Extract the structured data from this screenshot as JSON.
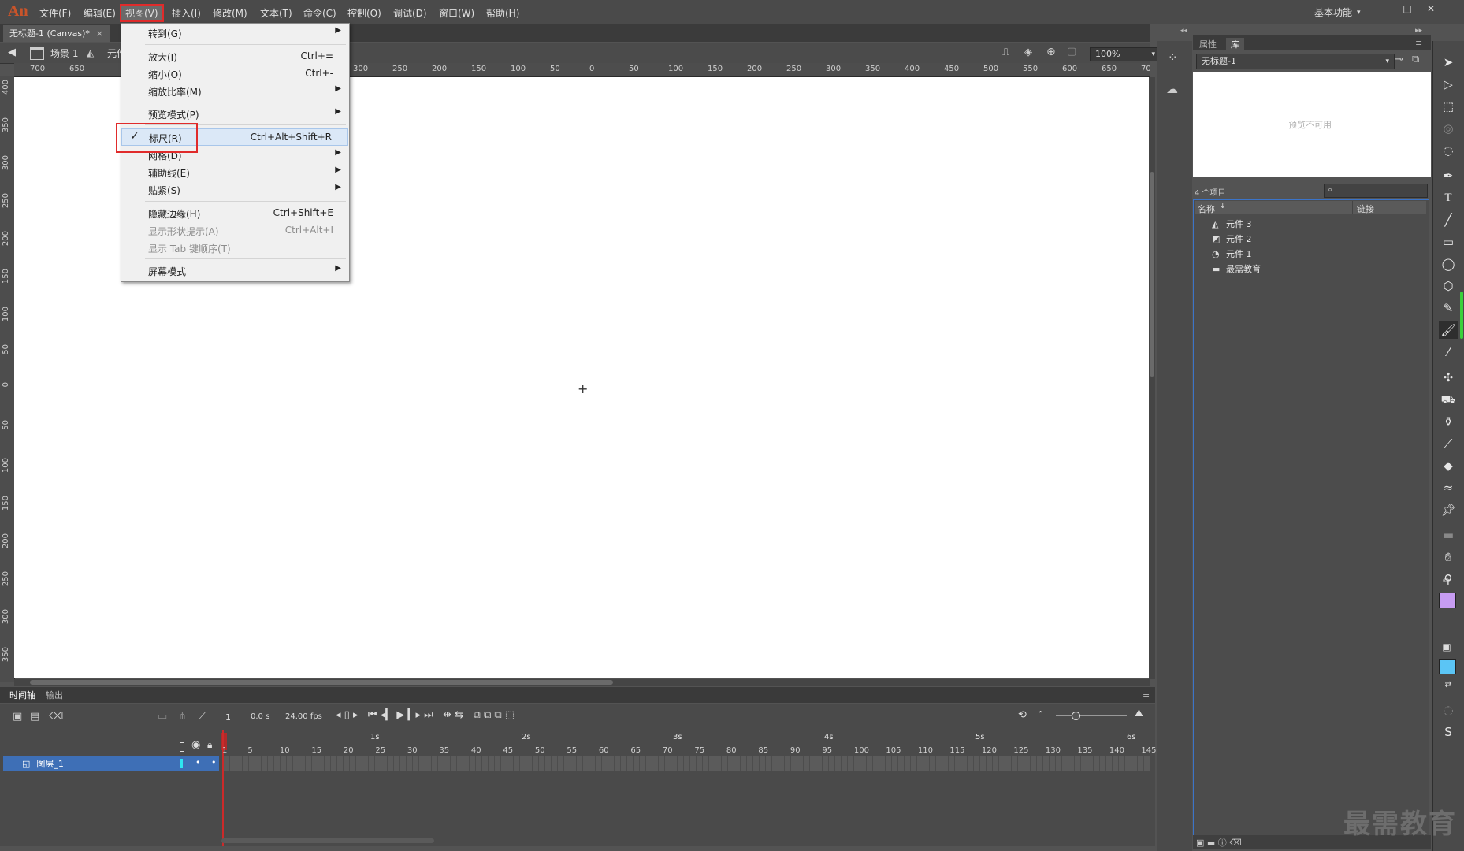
{
  "app": {
    "logo": "An",
    "workspace": "基本功能",
    "workspace_arrow": "▾"
  },
  "menubar": [
    "文件(F)",
    "编辑(E)",
    "视图(V)",
    "插入(I)",
    "修改(M)",
    "文本(T)",
    "命令(C)",
    "控制(O)",
    "调试(D)",
    "窗口(W)",
    "帮助(H)"
  ],
  "window_controls": {
    "minimize": "–",
    "maximize": "□",
    "close": "✕"
  },
  "document": {
    "tab_title": "无标题-1 (Canvas)*",
    "tab_close": "×",
    "scene": "场景 1",
    "symbol_crumb": "元件",
    "zoom": "100%"
  },
  "ruler_top": [
    "700",
    "650",
    "300",
    "250",
    "200",
    "150",
    "100",
    "50",
    "0",
    "50",
    "100",
    "150",
    "200",
    "250",
    "300",
    "350",
    "400",
    "450",
    "500",
    "550",
    "600",
    "650",
    "700"
  ],
  "ruler_left": [
    "400",
    "350",
    "300",
    "250",
    "200",
    "150",
    "100",
    "50",
    "0",
    "50",
    "100",
    "150",
    "200",
    "250",
    "300",
    "350"
  ],
  "view_menu": {
    "items": [
      {
        "label": "转到(G)",
        "shortcut": "",
        "submenu": true,
        "disabled": false
      },
      {
        "label": "放大(I)",
        "shortcut": "Ctrl+=",
        "submenu": false,
        "disabled": false
      },
      {
        "label": "缩小(O)",
        "shortcut": "Ctrl+-",
        "submenu": false,
        "disabled": false
      },
      {
        "label": "缩放比率(M)",
        "shortcut": "",
        "submenu": true,
        "disabled": false
      },
      {
        "label": "预览模式(P)",
        "shortcut": "",
        "submenu": true,
        "disabled": false
      },
      {
        "label": "标尺(R)",
        "shortcut": "Ctrl+Alt+Shift+R",
        "submenu": false,
        "disabled": false,
        "checked": true
      },
      {
        "label": "网格(D)",
        "shortcut": "",
        "submenu": true,
        "disabled": false
      },
      {
        "label": "辅助线(E)",
        "shortcut": "",
        "submenu": true,
        "disabled": false
      },
      {
        "label": "贴紧(S)",
        "shortcut": "",
        "submenu": true,
        "disabled": false
      },
      {
        "label": "隐藏边缘(H)",
        "shortcut": "Ctrl+Shift+E",
        "submenu": false,
        "disabled": false
      },
      {
        "label": "显示形状提示(A)",
        "shortcut": "Ctrl+Alt+I",
        "submenu": false,
        "disabled": true
      },
      {
        "label": "显示 Tab 键顺序(T)",
        "shortcut": "",
        "submenu": false,
        "disabled": true
      },
      {
        "label": "屏幕模式",
        "shortcut": "",
        "submenu": true,
        "disabled": false
      }
    ],
    "check_glyph": "✓",
    "arrow_glyph": "▶"
  },
  "timeline": {
    "tabs": [
      "时间轴",
      "输出"
    ],
    "current_frame": "1",
    "time": "0.0 s",
    "fps": "24.00 fps",
    "layer_name": "图层_1",
    "frame_numbers": [
      "1",
      "5",
      "10",
      "15",
      "20",
      "25",
      "30",
      "35",
      "40",
      "45",
      "50",
      "55",
      "60",
      "65",
      "70",
      "75",
      "80",
      "85",
      "90",
      "95",
      "100",
      "105",
      "110",
      "115",
      "120",
      "125",
      "130",
      "135",
      "140",
      "145"
    ],
    "second_markers": [
      "1s",
      "2s",
      "3s",
      "4s",
      "5s",
      "6s"
    ]
  },
  "library": {
    "tabs": [
      "属性",
      "库"
    ],
    "document": "无标题-1",
    "no_preview": "预览不可用",
    "count": "4 个项目",
    "col_name": "名称",
    "col_link": "链接",
    "items": [
      {
        "name": "元件 3",
        "icon": "movieclip-icon"
      },
      {
        "name": "元件 2",
        "icon": "graphic-icon"
      },
      {
        "name": "元件 1",
        "icon": "button-icon"
      },
      {
        "name": "最需教育",
        "icon": "folder-icon"
      }
    ]
  },
  "colors": {
    "stroke": "#c79cf2",
    "fill": "#5bc5f5",
    "accent": "#3e6fb6",
    "highlight": "#e02b2b"
  },
  "watermark": "最需教育"
}
